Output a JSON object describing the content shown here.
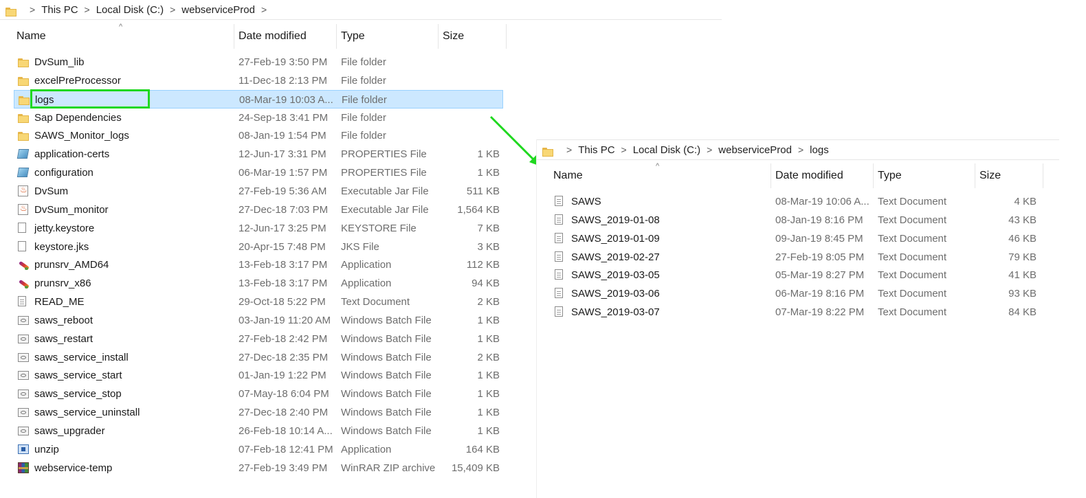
{
  "left": {
    "breadcrumb": [
      "This PC",
      "Local Disk (C:)",
      "webserviceProd"
    ],
    "columns": {
      "name": "Name",
      "date": "Date modified",
      "type": "Type",
      "size": "Size"
    },
    "rows": [
      {
        "icon": "folder-icon",
        "name": "DvSum_lib",
        "date": "27-Feb-19 3:50 PM",
        "type": "File folder",
        "size": ""
      },
      {
        "icon": "folder-icon",
        "name": "excelPreProcessor",
        "date": "11-Dec-18 2:13 PM",
        "type": "File folder",
        "size": ""
      },
      {
        "icon": "folder-icon",
        "name": "logs",
        "date": "08-Mar-19 10:03 A...",
        "type": "File folder",
        "size": ""
      },
      {
        "icon": "folder-icon",
        "name": "Sap Dependencies",
        "date": "24-Sep-18 3:41 PM",
        "type": "File folder",
        "size": ""
      },
      {
        "icon": "folder-icon",
        "name": "SAWS_Monitor_logs",
        "date": "08-Jan-19 1:54 PM",
        "type": "File folder",
        "size": ""
      },
      {
        "icon": "properties-icon",
        "name": "application-certs",
        "date": "12-Jun-17 3:31 PM",
        "type": "PROPERTIES File",
        "size": "1 KB"
      },
      {
        "icon": "properties-icon",
        "name": "configuration",
        "date": "06-Mar-19 1:57 PM",
        "type": "PROPERTIES File",
        "size": "1 KB"
      },
      {
        "icon": "jar-icon",
        "name": "DvSum",
        "date": "27-Feb-19 5:36 AM",
        "type": "Executable Jar File",
        "size": "511 KB"
      },
      {
        "icon": "jar-icon",
        "name": "DvSum_monitor",
        "date": "27-Dec-18 7:03 PM",
        "type": "Executable Jar File",
        "size": "1,564 KB"
      },
      {
        "icon": "blank-file-icon",
        "name": "jetty.keystore",
        "date": "12-Jun-17 3:25 PM",
        "type": "KEYSTORE File",
        "size": "7 KB"
      },
      {
        "icon": "blank-file-icon",
        "name": "keystore.jks",
        "date": "20-Apr-15 7:48 PM",
        "type": "JKS File",
        "size": "3 KB"
      },
      {
        "icon": "feather-app-icon",
        "name": "prunsrv_AMD64",
        "date": "13-Feb-18 3:17 PM",
        "type": "Application",
        "size": "112 KB"
      },
      {
        "icon": "feather-app-icon",
        "name": "prunsrv_x86",
        "date": "13-Feb-18 3:17 PM",
        "type": "Application",
        "size": "94 KB"
      },
      {
        "icon": "text-document-icon",
        "name": "READ_ME",
        "date": "29-Oct-18 5:22 PM",
        "type": "Text Document",
        "size": "2 KB"
      },
      {
        "icon": "batch-file-icon",
        "name": "saws_reboot",
        "date": "03-Jan-19 11:20 AM",
        "type": "Windows Batch File",
        "size": "1 KB"
      },
      {
        "icon": "batch-file-icon",
        "name": "saws_restart",
        "date": "27-Feb-18 2:42 PM",
        "type": "Windows Batch File",
        "size": "1 KB"
      },
      {
        "icon": "batch-file-icon",
        "name": "saws_service_install",
        "date": "27-Dec-18 2:35 PM",
        "type": "Windows Batch File",
        "size": "2 KB"
      },
      {
        "icon": "batch-file-icon",
        "name": "saws_service_start",
        "date": "01-Jan-19 1:22 PM",
        "type": "Windows Batch File",
        "size": "1 KB"
      },
      {
        "icon": "batch-file-icon",
        "name": "saws_service_stop",
        "date": "07-May-18 6:04 PM",
        "type": "Windows Batch File",
        "size": "1 KB"
      },
      {
        "icon": "batch-file-icon",
        "name": "saws_service_uninstall",
        "date": "27-Dec-18 2:40 PM",
        "type": "Windows Batch File",
        "size": "1 KB"
      },
      {
        "icon": "batch-file-icon",
        "name": "saws_upgrader",
        "date": "26-Feb-18 10:14 A...",
        "type": "Windows Batch File",
        "size": "1 KB"
      },
      {
        "icon": "unzip-app-icon",
        "name": "unzip",
        "date": "07-Feb-18 12:41 PM",
        "type": "Application",
        "size": "164 KB"
      },
      {
        "icon": "winrar-archive-icon",
        "name": "webservice-temp",
        "date": "27-Feb-19 3:49 PM",
        "type": "WinRAR ZIP archive",
        "size": "15,409 KB"
      }
    ],
    "selected_row": "logs"
  },
  "right": {
    "breadcrumb": [
      "This PC",
      "Local Disk (C:)",
      "webserviceProd",
      "logs"
    ],
    "columns": {
      "name": "Name",
      "date": "Date modified",
      "type": "Type",
      "size": "Size"
    },
    "rows": [
      {
        "icon": "text-document-icon",
        "name": "SAWS",
        "date": "08-Mar-19 10:06 A...",
        "type": "Text Document",
        "size": "4 KB"
      },
      {
        "icon": "text-document-icon",
        "name": "SAWS_2019-01-08",
        "date": "08-Jan-19 8:16 PM",
        "type": "Text Document",
        "size": "43 KB"
      },
      {
        "icon": "text-document-icon",
        "name": "SAWS_2019-01-09",
        "date": "09-Jan-19 8:45 PM",
        "type": "Text Document",
        "size": "46 KB"
      },
      {
        "icon": "text-document-icon",
        "name": "SAWS_2019-02-27",
        "date": "27-Feb-19 8:05 PM",
        "type": "Text Document",
        "size": "79 KB"
      },
      {
        "icon": "text-document-icon",
        "name": "SAWS_2019-03-05",
        "date": "05-Mar-19 8:27 PM",
        "type": "Text Document",
        "size": "41 KB"
      },
      {
        "icon": "text-document-icon",
        "name": "SAWS_2019-03-06",
        "date": "06-Mar-19 8:16 PM",
        "type": "Text Document",
        "size": "93 KB"
      },
      {
        "icon": "text-document-icon",
        "name": "SAWS_2019-03-07",
        "date": "07-Mar-19 8:22 PM",
        "type": "Text Document",
        "size": "84 KB"
      }
    ]
  },
  "colors": {
    "selection_bg": "#cce8ff",
    "selection_border": "#99d1ff",
    "highlight_box": "#1fd81f",
    "arrow": "#1fd81f"
  }
}
